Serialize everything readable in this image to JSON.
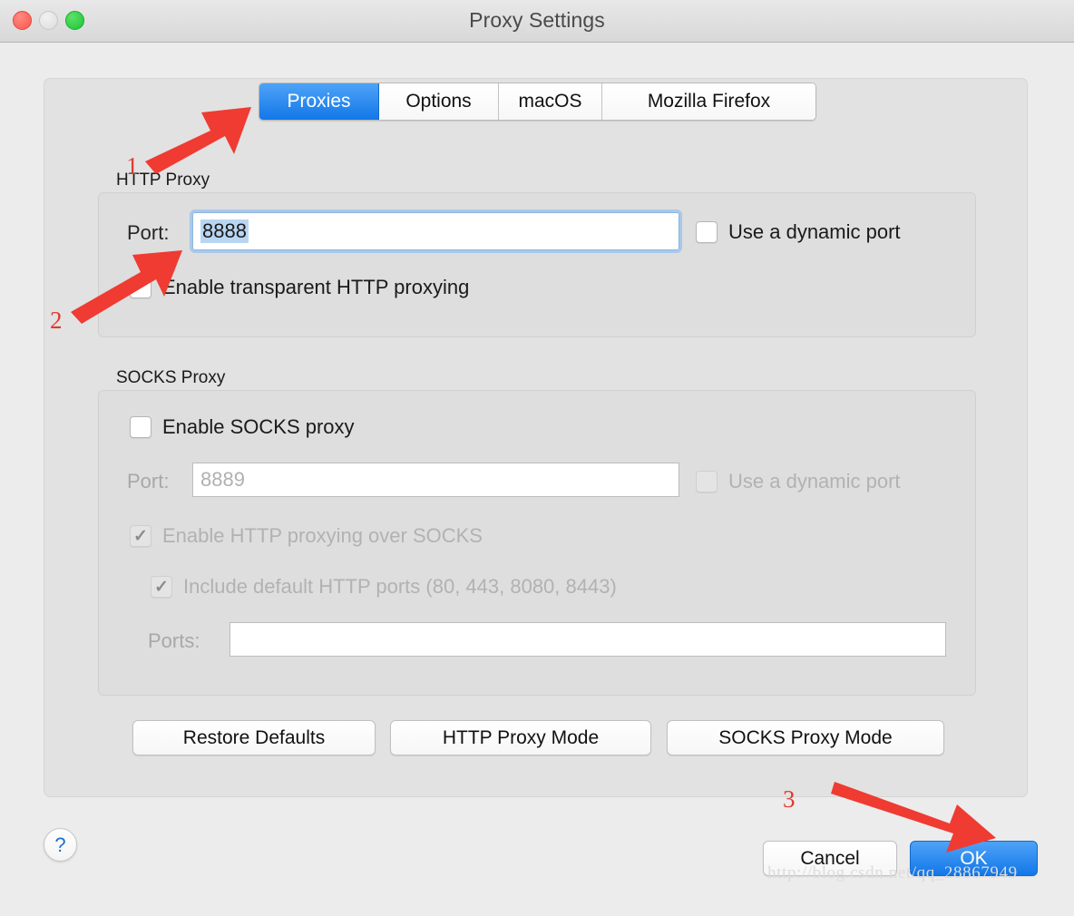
{
  "window": {
    "title": "Proxy Settings",
    "traffic_lights": [
      "close-red",
      "minimize-gray",
      "zoom-green"
    ]
  },
  "tabs": [
    {
      "label": "Proxies",
      "active": true
    },
    {
      "label": "Options",
      "active": false
    },
    {
      "label": "macOS",
      "active": false
    },
    {
      "label": "Mozilla Firefox",
      "active": false
    }
  ],
  "http_proxy": {
    "group_label": "HTTP Proxy",
    "port_label": "Port:",
    "port_value": "8888",
    "port_selected": true,
    "dynamic_port": {
      "label": "Use a dynamic port",
      "checked": false,
      "enabled": true
    },
    "transparent": {
      "label": "Enable transparent HTTP proxying",
      "checked": false,
      "enabled": true
    }
  },
  "socks_proxy": {
    "group_label": "SOCKS Proxy",
    "enable": {
      "label": "Enable SOCKS proxy",
      "checked": false,
      "enabled": true
    },
    "port_label": "Port:",
    "port_value": "8889",
    "port_enabled": false,
    "dynamic_port": {
      "label": "Use a dynamic port",
      "checked": false,
      "enabled": false
    },
    "http_over_socks": {
      "label": "Enable HTTP proxying over SOCKS",
      "checked": true,
      "enabled": false
    },
    "include_default_ports": {
      "label": "Include default HTTP ports (80, 443, 8080, 8443)",
      "checked": true,
      "enabled": false
    },
    "ports_label": "Ports:",
    "ports_value": ""
  },
  "mode_buttons": [
    {
      "label": "Restore Defaults"
    },
    {
      "label": "HTTP Proxy Mode"
    },
    {
      "label": "SOCKS Proxy Mode"
    }
  ],
  "footer": {
    "help_glyph": "?",
    "cancel_label": "Cancel",
    "ok_label": "OK",
    "watermark": "http://blog.csdn.net/qq_28867949"
  },
  "annotations": {
    "arrow_color": "#ef3b32",
    "steps": [
      {
        "number": "1",
        "target": "proxies-tab"
      },
      {
        "number": "2",
        "target": "http-port-field"
      },
      {
        "number": "3",
        "target": "ok-button"
      }
    ]
  }
}
